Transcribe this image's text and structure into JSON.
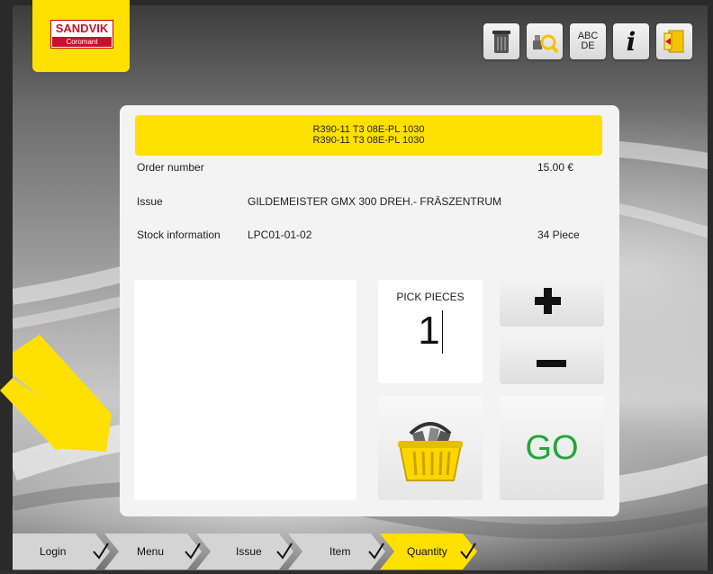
{
  "brand": {
    "logo_top": "SANDVIK",
    "logo_bottom": "Coromant",
    "accent": "#ffe000"
  },
  "toolbar": {
    "icons": [
      {
        "name": "trash-bin-icon"
      },
      {
        "name": "search-tool-icon"
      },
      {
        "name": "keyboard-abc-icon",
        "text_top": "ABC",
        "text_bottom": "DE"
      },
      {
        "name": "info-icon",
        "glyph": "i"
      },
      {
        "name": "exit-door-icon"
      }
    ]
  },
  "item": {
    "title_line1": "R390-11 T3 08E-PL 1030",
    "title_line2": "R390-11 T3 08E-PL 1030",
    "order_number_label": "Order number",
    "price": "15.00 €",
    "issue_label": "Issue",
    "issue_value": "GILDEMEISTER GMX 300 DREH.- FRÄSZENTRUM",
    "stock_label": "Stock information",
    "stock_location": "LPC01-01-02",
    "stock_quantity": "34 Piece"
  },
  "picker": {
    "label": "PICK PIECES",
    "value": "1",
    "plus_label": "+",
    "minus_label": "–",
    "go_label": "GO"
  },
  "breadcrumb": [
    {
      "label": "Login",
      "state": "done"
    },
    {
      "label": "Menu",
      "state": "done"
    },
    {
      "label": "Issue",
      "state": "done"
    },
    {
      "label": "Item",
      "state": "done"
    },
    {
      "label": "Quantity",
      "state": "active"
    }
  ],
  "colors": {
    "go": "#22a63a",
    "active_step": "#ffe000",
    "inactive_step": "#d4d4d4"
  }
}
